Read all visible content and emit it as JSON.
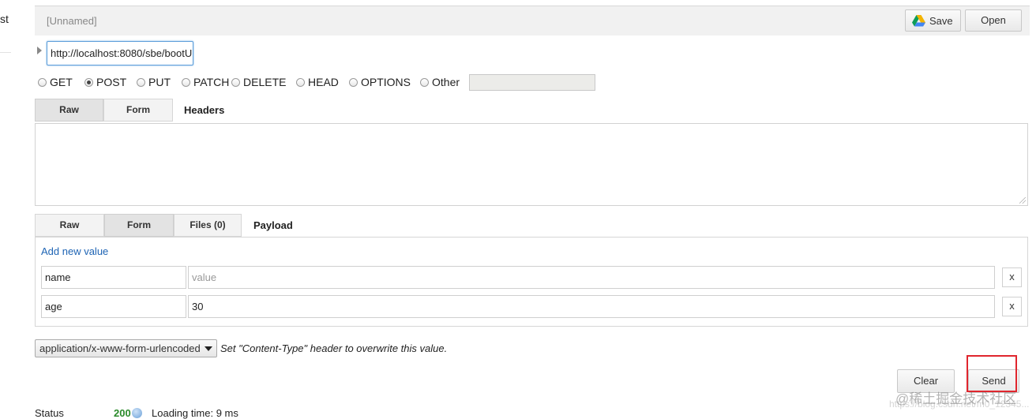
{
  "left_panel": {
    "fragment": "st"
  },
  "topbar": {
    "title": "[Unnamed]",
    "save_label": "Save",
    "open_label": "Open"
  },
  "request": {
    "url": "http://localhost:8080/sbe/bootU"
  },
  "methods": [
    {
      "label": "GET",
      "selected": false
    },
    {
      "label": "POST",
      "selected": true
    },
    {
      "label": "PUT",
      "selected": false
    },
    {
      "label": "PATCH",
      "selected": false
    },
    {
      "label": "DELETE",
      "selected": false
    },
    {
      "label": "HEAD",
      "selected": false
    },
    {
      "label": "OPTIONS",
      "selected": false
    },
    {
      "label": "Other",
      "selected": false
    }
  ],
  "headers": {
    "tabs": [
      "Raw",
      "Form"
    ],
    "active_tab": "Raw",
    "label": "Headers",
    "value": ""
  },
  "payload": {
    "tabs": [
      "Raw",
      "Form",
      "Files (0)"
    ],
    "active_tab": "Form",
    "label": "Payload",
    "add_link": "Add new value",
    "rows": [
      {
        "name": "name",
        "value": "",
        "value_placeholder": "value",
        "remove": "x"
      },
      {
        "name": "age",
        "value": "30",
        "value_placeholder": "value",
        "remove": "x"
      }
    ]
  },
  "content_type": {
    "selected": "application/x-www-form-urlencoded",
    "hint": "Set \"Content-Type\" header to overwrite this value."
  },
  "actions": {
    "clear_label": "Clear",
    "send_label": "Send",
    "highlight_color": "#e0262e"
  },
  "status": {
    "label": "Status",
    "code": "200",
    "loading_label": "Loading time:",
    "loading_value": "9 ms"
  },
  "watermark": {
    "text": "@稀土掘金技术社区",
    "url": "https://blog.csdn.net/m0_12345..."
  },
  "colors": {
    "accent_blue": "#1e64b4",
    "status_ok": "#2a8a2a",
    "focus_border": "#5b9dd9"
  },
  "icons": {
    "save": "google-drive-icon",
    "expander": "triangle-right-icon",
    "select_caret": "caret-down-icon"
  }
}
